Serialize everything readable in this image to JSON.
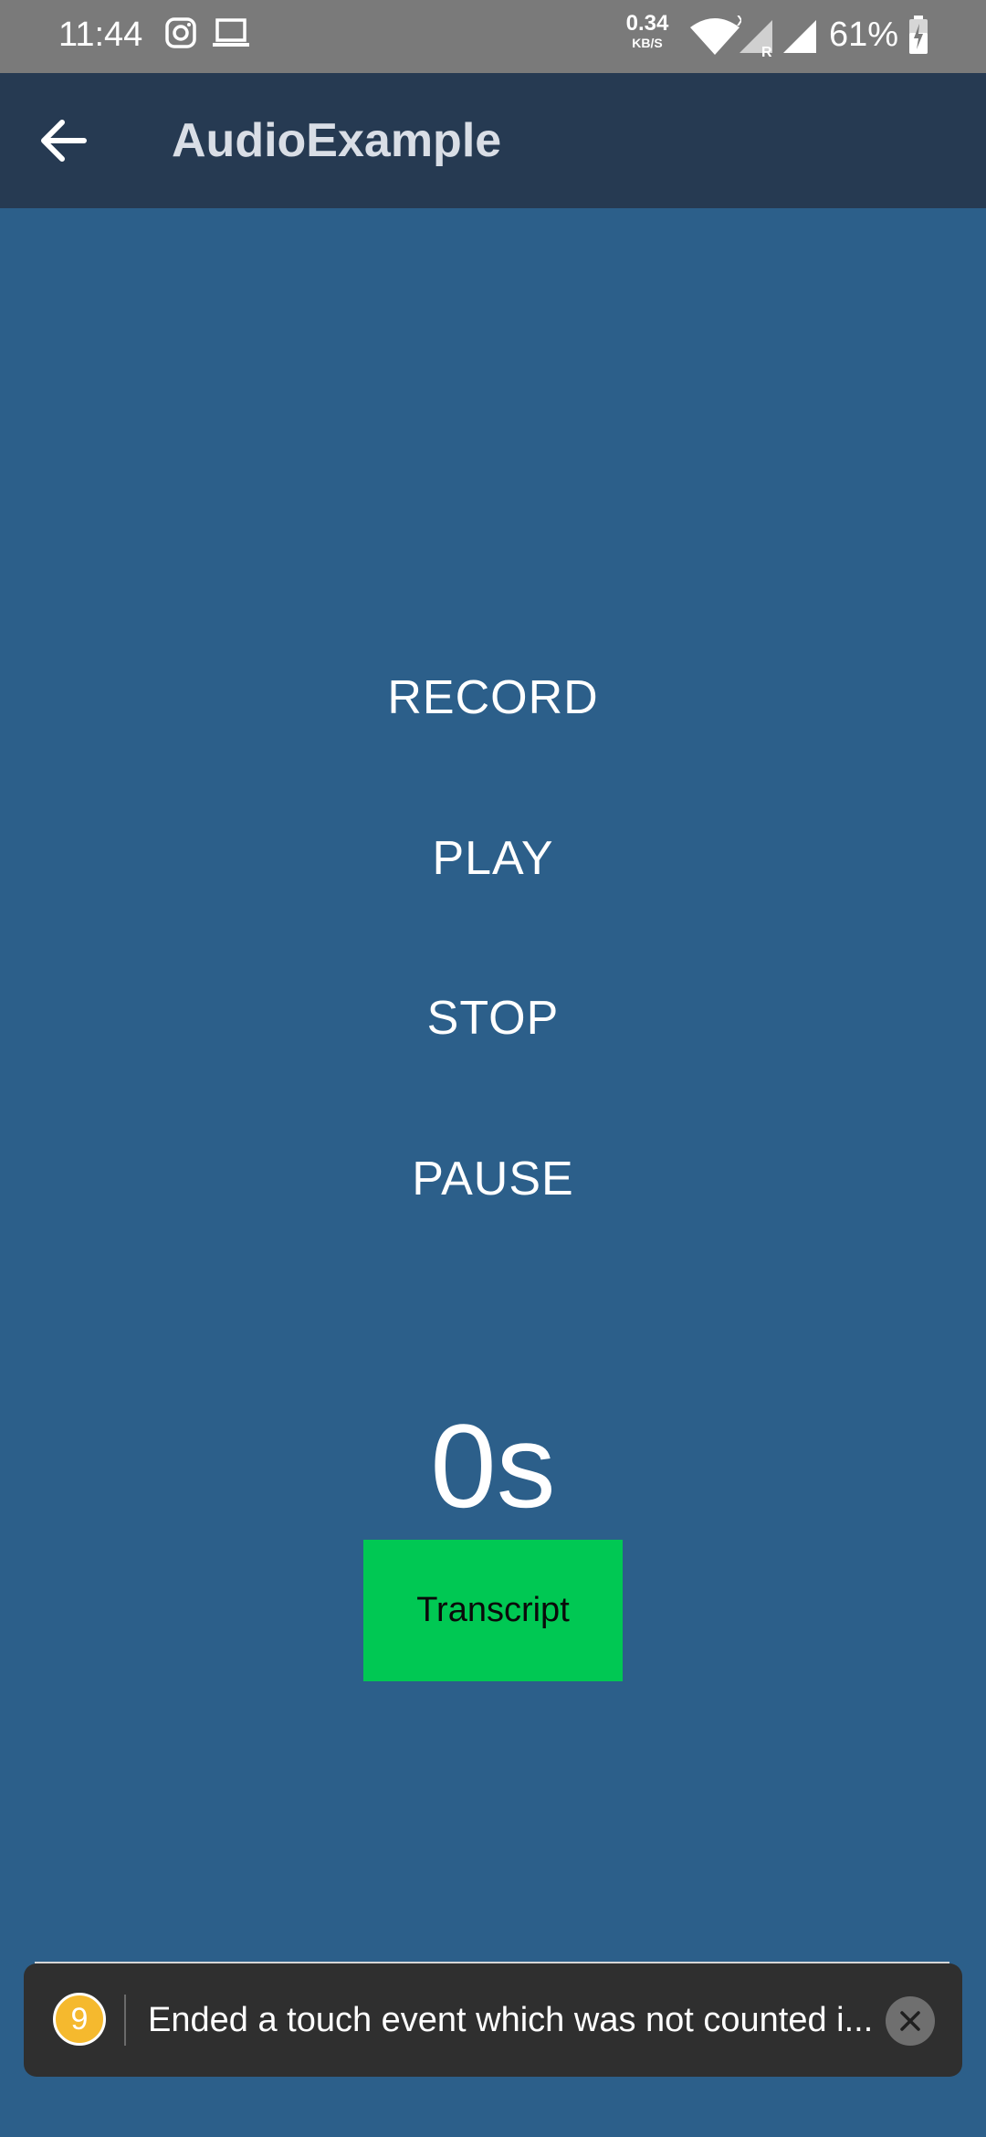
{
  "status_bar": {
    "time": "11:44",
    "net_speed_value": "0.34",
    "net_speed_unit": "KB/S",
    "battery": "61%",
    "icons": [
      "instagram-icon",
      "laptop-icon",
      "wifi-icon",
      "signal-icon",
      "signal-icon",
      "battery-icon"
    ]
  },
  "app_bar": {
    "title": "AudioExample",
    "back_icon": "arrow-left-icon"
  },
  "controls": {
    "record": "RECORD",
    "play": "PLAY",
    "stop": "STOP",
    "pause": "PAUSE"
  },
  "timer": "0s",
  "transcript_button": "Transcript",
  "toast": {
    "badge": "9",
    "message": "Ended a touch event which was not counted i...",
    "close_icon": "close-icon"
  },
  "colors": {
    "status_bar": "#7a7a7a",
    "app_bar": "#263a52",
    "background": "#2c5f8a",
    "transcript_button": "#00c853",
    "toast_background": "#2f2f2f",
    "badge": "#f5b92e"
  }
}
